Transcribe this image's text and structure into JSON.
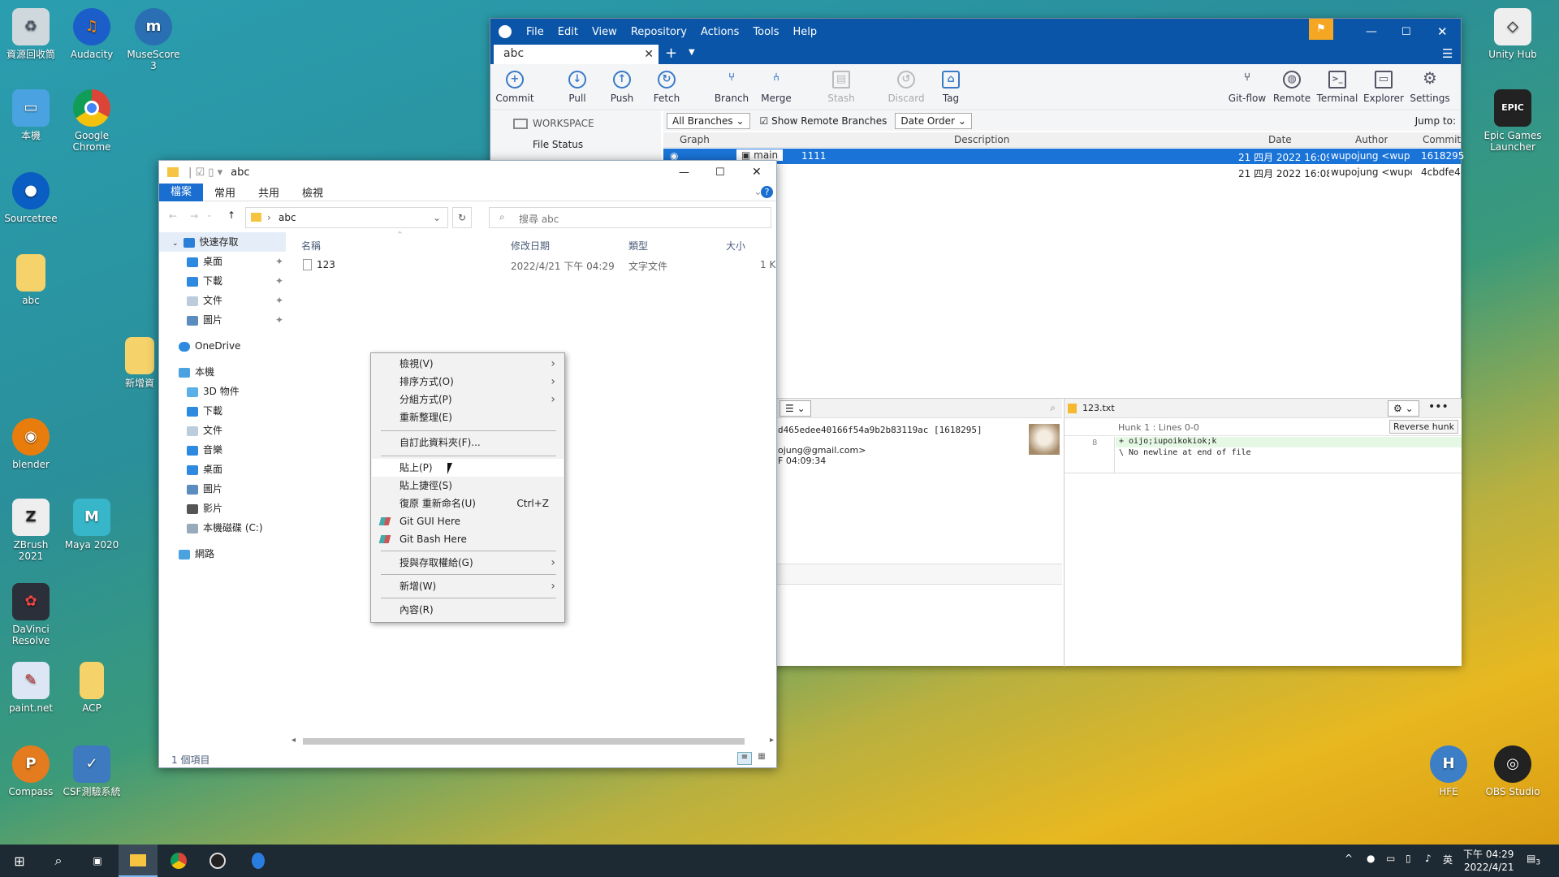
{
  "desktop_icons": [
    {
      "label": "資源回收筒",
      "icon": "recycle-bin-icon"
    },
    {
      "label": "Audacity",
      "icon": "audacity-icon"
    },
    {
      "label": "MuseScore 3",
      "icon": "musescore-icon"
    },
    {
      "label": "本機",
      "icon": "this-pc-icon"
    },
    {
      "label": "Google Chrome",
      "icon": "chrome-icon"
    },
    {
      "label": "Sourcetree",
      "icon": "sourcetree-icon"
    },
    {
      "label": "abc",
      "icon": "folder-icon"
    },
    {
      "label": "新增資",
      "icon": "folder-icon"
    },
    {
      "label": "blender",
      "icon": "blender-icon"
    },
    {
      "label": "ZBrush 2021",
      "icon": "zbrush-icon"
    },
    {
      "label": "Maya 2020",
      "icon": "maya-icon"
    },
    {
      "label": "DaVinci Resolve",
      "icon": "davinci-icon"
    },
    {
      "label": "paint.net",
      "icon": "paintnet-icon"
    },
    {
      "label": "ACP",
      "icon": "folder-icon"
    },
    {
      "label": "Compass",
      "icon": "compass-icon"
    },
    {
      "label": "CSF測驗系統",
      "icon": "csf-icon"
    },
    {
      "label": "Unity Hub",
      "icon": "unity-icon"
    },
    {
      "label": "Epic Games Launcher",
      "icon": "epic-icon"
    },
    {
      "label": "HFE",
      "icon": "hfe-icon"
    },
    {
      "label": "OBS Studio",
      "icon": "obs-icon"
    }
  ],
  "sourcetree": {
    "menu": [
      "File",
      "Edit",
      "View",
      "Repository",
      "Actions",
      "Tools",
      "Help"
    ],
    "tab": "abc",
    "toolbar_left": [
      "Commit",
      "Pull",
      "Push",
      "Fetch",
      "Branch",
      "Merge",
      "Stash",
      "Discard",
      "Tag"
    ],
    "toolbar_right": [
      "Git-flow",
      "Remote",
      "Terminal",
      "Explorer",
      "Settings"
    ],
    "workspace": "WORKSPACE",
    "file_status": "File Status",
    "branches_dropdown": "All Branches",
    "show_remote": "Show Remote Branches",
    "order_dropdown": "Date Order",
    "jump_to": "Jump to:",
    "columns": {
      "graph": "Graph",
      "description": "Description",
      "date": "Date",
      "author": "Author",
      "commit": "Commit"
    },
    "commits": [
      {
        "branch": "main",
        "description": "1111",
        "date": "21 四月 2022 16:09",
        "author": "wupojung <wup",
        "commit": "1618295"
      },
      {
        "branch": "",
        "description": "",
        "date": "21 四月 2022 16:08",
        "author": "wupojung <wupc",
        "commit": "4cbdfe4"
      }
    ],
    "detail": {
      "hash": "d465edee40166f54a9b2b83119ac [1618295]",
      "email": "ojung@gmail.com>",
      "time": "F 04:09:34"
    },
    "diff": {
      "file": "123.txt",
      "hunk": "Hunk 1 : Lines 0-0",
      "reverse": "Reverse hunk",
      "line_no": "8",
      "added": "+ oijo;iupoikokiok;k",
      "note": "\\  No newline at end of file"
    }
  },
  "explorer": {
    "title": "abc",
    "ribbon": [
      "檔案",
      "常用",
      "共用",
      "檢視"
    ],
    "path": "abc",
    "search_placeholder": "搜尋 abc",
    "columns": {
      "name": "名稱",
      "modified": "修改日期",
      "type": "類型",
      "size": "大小"
    },
    "files": [
      {
        "name": "123",
        "modified": "2022/4/21 下午 04:29",
        "type": "文字文件",
        "size": "1 K"
      }
    ],
    "nav": {
      "quick": "快速存取",
      "desktop": "桌面",
      "downloads": "下載",
      "documents": "文件",
      "pictures": "圖片",
      "onedrive": "OneDrive",
      "thispc": "本機",
      "objects3d": "3D 物件",
      "downloads2": "下載",
      "documents2": "文件",
      "music": "音樂",
      "desktop2": "桌面",
      "pictures2": "圖片",
      "videos": "影片",
      "disk": "本機磁碟 (C:)",
      "network": "網路"
    },
    "status": "1 個項目"
  },
  "context_menu": [
    {
      "label": "檢視(V)",
      "sub": true
    },
    {
      "label": "排序方式(O)",
      "sub": true
    },
    {
      "label": "分組方式(P)",
      "sub": true
    },
    {
      "label": "重新整理(E)"
    },
    {
      "label": "自訂此資料夾(F)..."
    },
    {
      "label": "貼上(P)"
    },
    {
      "label": "貼上捷徑(S)"
    },
    {
      "label": "復原 重新命名(U)",
      "shortcut": "Ctrl+Z"
    },
    {
      "label": "Git GUI Here"
    },
    {
      "label": "Git Bash Here"
    },
    {
      "label": "授與存取權給(G)",
      "sub": true
    },
    {
      "label": "新增(W)",
      "sub": true
    },
    {
      "label": "內容(R)"
    }
  ],
  "taskbar": {
    "time": "下午 04:29",
    "date": "2022/4/21",
    "lang": "英",
    "notif": "3"
  }
}
